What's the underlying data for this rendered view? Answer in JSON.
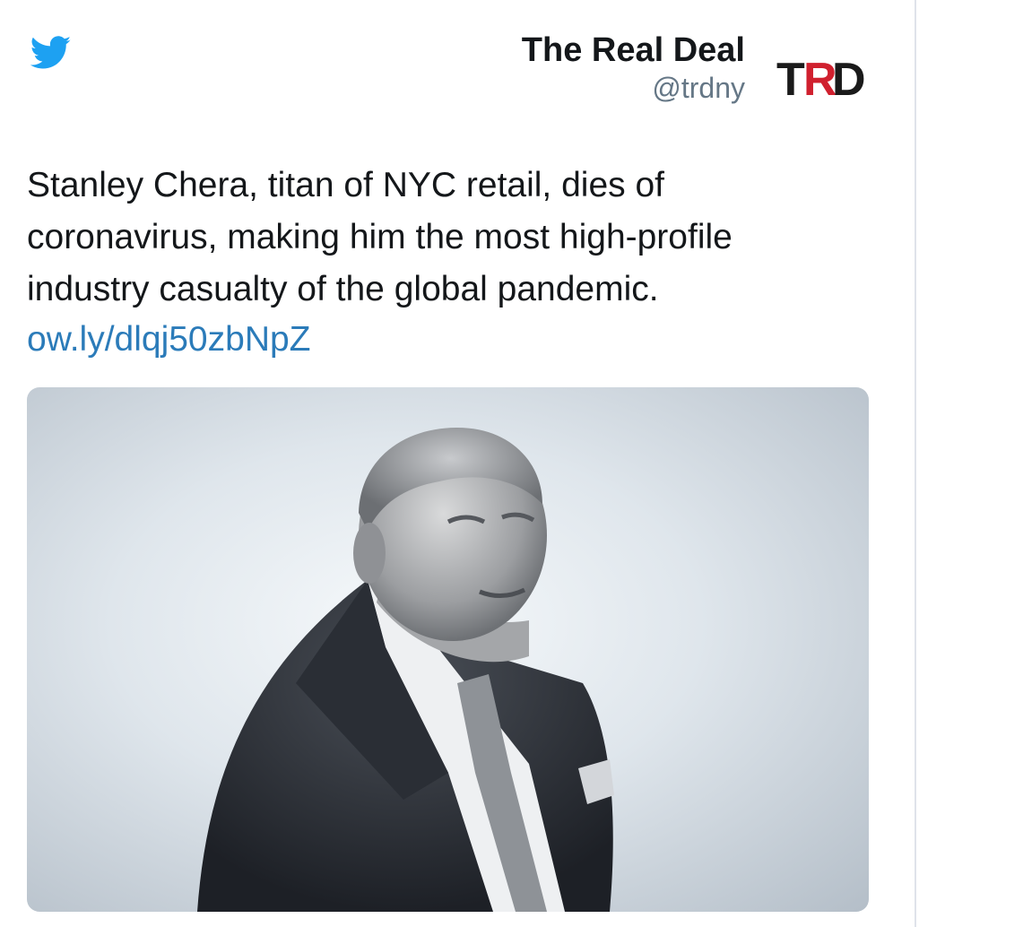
{
  "header": {
    "brand_icon": "twitter-bird-icon",
    "account_name": "The Real Deal",
    "account_handle": "@trdny",
    "avatar": {
      "icon": "trd-logo-avatar",
      "text_black_1": "T",
      "text_red": "R",
      "text_black_2": "D",
      "colors": {
        "black": "#1a1a1a",
        "red": "#d0202e"
      }
    }
  },
  "tweet": {
    "text": "Stanley Chera, titan of NYC retail, dies of coronavirus, making him the most high-profile industry casualty of the global pandemic.",
    "link": "ow.ly/dlqj50zbNpZ"
  },
  "media": {
    "icon": "portrait-photo"
  },
  "colors": {
    "twitter_blue": "#1da1f2",
    "link_blue": "#2b7bb9",
    "text": "#14171a",
    "muted": "#657786"
  }
}
